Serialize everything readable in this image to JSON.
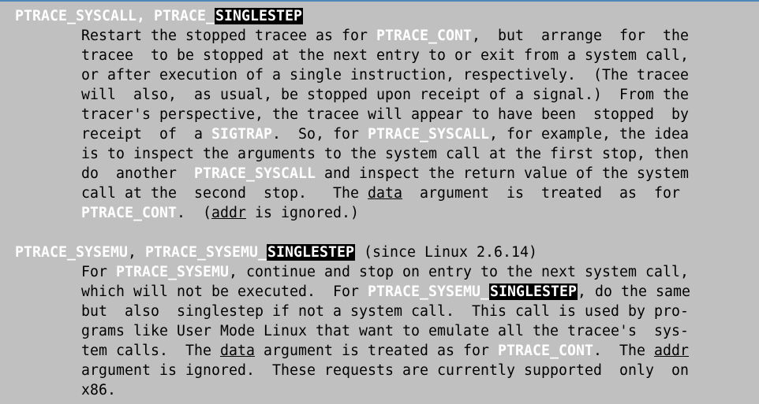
{
  "manpage": {
    "section1": {
      "head_a": "PTRACE_SYSCALL",
      "sep": ", ",
      "head_b_prefix": "PTRACE_",
      "head_b_match": "SINGLESTEP",
      "l1_a": "Restart the stopped tracee as for ",
      "l1_b": "PTRACE_CONT",
      "l1_c": ",  but  arrange  for  the",
      "l2": "tracee  to be stopped at the next entry to or exit from a system call,",
      "l3": "or after execution of a single instruction, respectively.  (The tracee",
      "l4": "will  also,  as usual, be stopped upon receipt of a signal.)  From the",
      "l5": "tracer's perspective, the tracee will appear to have been  stopped  by",
      "l6_a": "receipt  of  a ",
      "l6_b": "SIGTRAP",
      "l6_c": ".  So, for ",
      "l6_d": "PTRACE_SYSCALL",
      "l6_e": ", for example, the idea",
      "l7": "is to inspect the arguments to the system call at the first stop, then",
      "l8_a": "do  another  ",
      "l8_b": "PTRACE_SYSCALL",
      "l8_c": " and inspect the return value of the system",
      "l9_a": "call at the  second  stop.   The ",
      "l9_b": "data",
      "l9_c": "  argument  is  treated  as  for",
      "l10_a": "PTRACE_CONT",
      "l10_b": ".  (",
      "l10_c": "addr",
      "l10_d": " is ignored.)"
    },
    "section2": {
      "head_a": "PTRACE_SYSEMU",
      "sep": ", ",
      "head_b_prefix": "PTRACE_SYSEMU_",
      "head_b_match": "SINGLESTEP",
      "head_tail": " (since Linux 2.6.14)",
      "l1_a": "For ",
      "l1_b": "PTRACE_SYSEMU",
      "l1_c": ", continue and stop on entry to the next system call,",
      "l2_a": "which will not be executed.  For ",
      "l2_b": "PTRACE_SYSEMU_",
      "l2_c": "SINGLESTEP",
      "l2_d": ", do the same",
      "l3": "but  also  singlestep if not a system call.  This call is used by pro-",
      "l4": "grams like User Mode Linux that want to emulate all the tracee's  sys-",
      "l5_a": "tem calls.  The ",
      "l5_b": "data",
      "l5_c": " argument is treated as for ",
      "l5_d": "PTRACE_CONT",
      "l5_e": ".  The ",
      "l5_f": "addr",
      "l6": "argument is ignored.  These requests are currently supported  only  on",
      "l7": "x86."
    }
  }
}
